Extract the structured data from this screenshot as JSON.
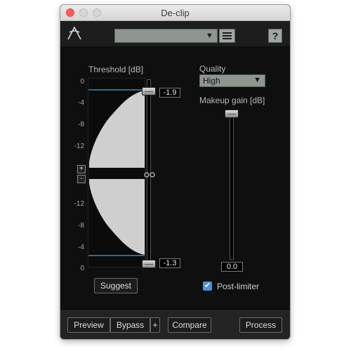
{
  "window": {
    "title": "De-clip"
  },
  "toolbar": {
    "preset_value": "",
    "logo_icon": "izotope-logo-icon",
    "menu_icon": "hamburger-icon",
    "help_label": "?"
  },
  "threshold": {
    "label": "Threshold [dB]",
    "ticks_top": [
      "0",
      "-4",
      "-8",
      "-12"
    ],
    "ticks_bottom": [
      "-12",
      "-8",
      "-4",
      "0"
    ],
    "plus_label": "+",
    "minus_label": "-",
    "upper_value": "-1.9",
    "lower_value": "-1.3",
    "upper_level_db": -1.9,
    "lower_level_db": -1.3
  },
  "quality": {
    "label": "Quality",
    "selected": "High"
  },
  "makeup": {
    "label": "Makeup gain [dB]",
    "value": "0.0",
    "level_db": 0.0
  },
  "suggest_label": "Suggest",
  "post_limiter": {
    "label": "Post-limiter",
    "checked": true
  },
  "bottom": {
    "preview_label": "Preview",
    "bypass_label": "Bypass",
    "plus_label": "+",
    "compare_label": "Compare",
    "process_label": "Process"
  },
  "colors": {
    "accent": "#4c93d9",
    "panel": "#0f0f0f",
    "histogram": "#cfcfcf",
    "threshold_line": "#4aa3df"
  }
}
